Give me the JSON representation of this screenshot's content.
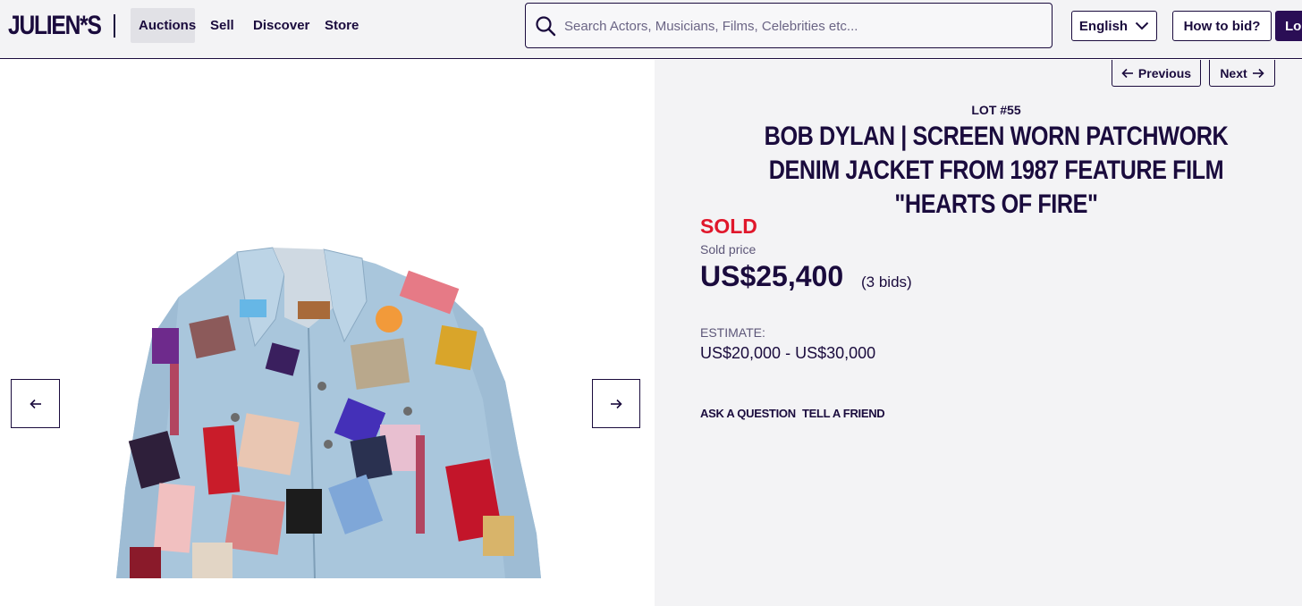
{
  "header": {
    "logo": "JULIEN*S",
    "nav": [
      "Auctions",
      "Sell",
      "Discover",
      "Store"
    ],
    "search_placeholder": "Search Actors, Musicians, Films, Celebrities etc...",
    "language": "English",
    "how_to_bid": "How to bid?",
    "login": "Lo"
  },
  "navigation": {
    "previous": "Previous",
    "next": "Next"
  },
  "lot": {
    "number": "LOT #55",
    "title": "BOB DYLAN | SCREEN WORN PATCHWORK DENIM JACKET FROM 1987 FEATURE FILM \"HEARTS OF FIRE\"",
    "status": "SOLD",
    "sold_price_label": "Sold price",
    "sold_price": "US$25,400",
    "bids": "(3 bids)",
    "estimate_label": "ESTIMATE:",
    "estimate": "US$20,000 - US$30,000",
    "ask_question": "ASK A QUESTION",
    "tell_friend": "TELL A FRIEND"
  },
  "colors": {
    "brand": "#1a0b3d",
    "sold": "#e0172b",
    "panel_bg": "#f3f3f5"
  }
}
